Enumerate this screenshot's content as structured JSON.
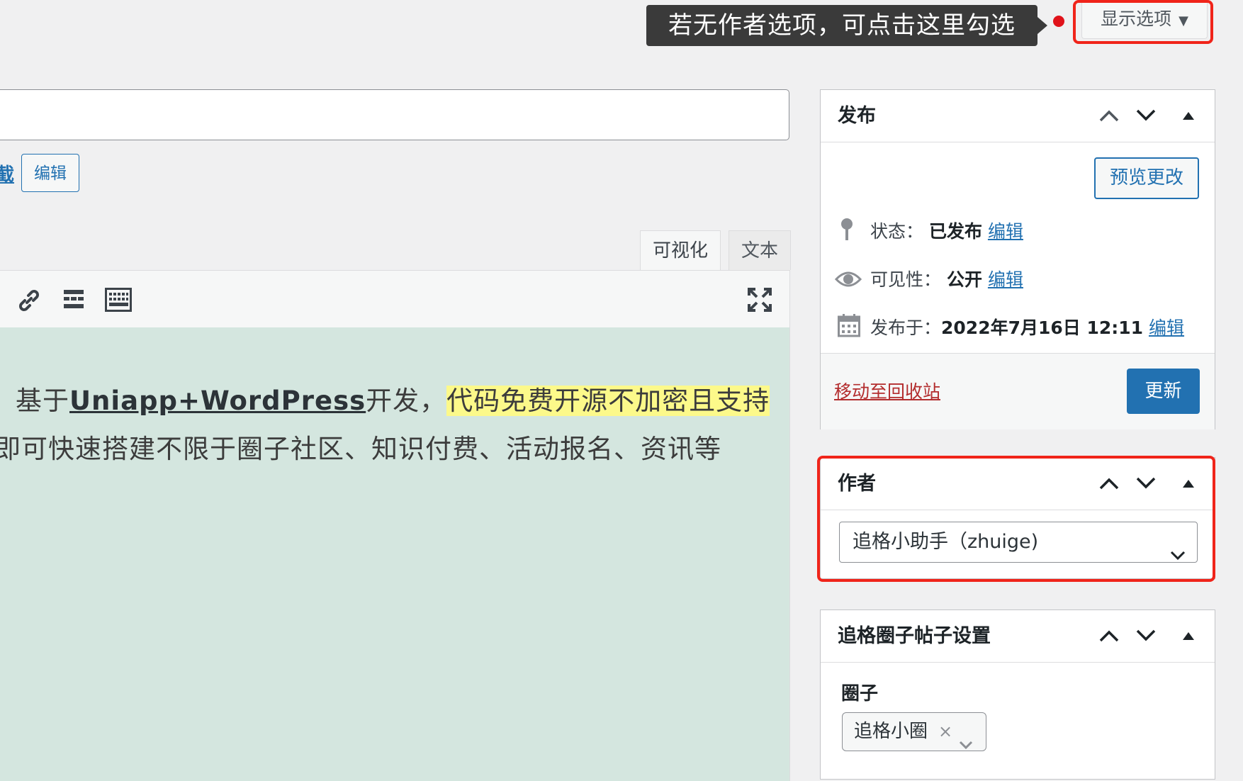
{
  "top": {
    "callout_text": "若无作者选项，可点击这里勾选",
    "screen_options_label": "显示选项",
    "screen_options_arrow": "▼"
  },
  "permalink": {
    "tail_text": "截",
    "edit_label": "编辑"
  },
  "editor": {
    "tabs": [
      {
        "label": "可视化",
        "active": true
      },
      {
        "label": "文本",
        "active": false
      }
    ],
    "toolbar_icons": [
      "link-icon",
      "read-more-icon",
      "keyboard-icon",
      "fullscreen-icon"
    ],
    "content": {
      "line1_prefix": "基于",
      "line1_link": "Uniapp+WordPress",
      "line1_mid": "开发，",
      "line1_highlight": "代码免费开源不加密且支持",
      "line2": "即可快速搭建不限于圈子社区、知识付费、活动报名、资讯等"
    },
    "content_bg": "#d4e6df",
    "highlight_color": "#fcf98a"
  },
  "publish_box": {
    "title": "发布",
    "preview_label": "预览更改",
    "status_label": "状态：",
    "status_value": "已发布",
    "status_edit": "编辑",
    "visibility_label": "可见性：",
    "visibility_value": "公开",
    "visibility_edit": "编辑",
    "date_label": "发布于：",
    "date_value": "2022年7月16日 12:11",
    "date_edit": "编辑",
    "trash_label": "移动至回收站",
    "update_label": "更新"
  },
  "author_box": {
    "title": "作者",
    "selected_author": "追格小助手（zhuige)"
  },
  "zhuige_box": {
    "title": "追格圈子帖子设置",
    "circle_label": "圈子",
    "circle_value": "追格小圈",
    "remove_glyph": "×"
  },
  "colors": {
    "accent": "#2271b1",
    "highlight_border": "#f0241a",
    "trash": "#b32d2e",
    "callout_bg": "#3a3a3a"
  }
}
